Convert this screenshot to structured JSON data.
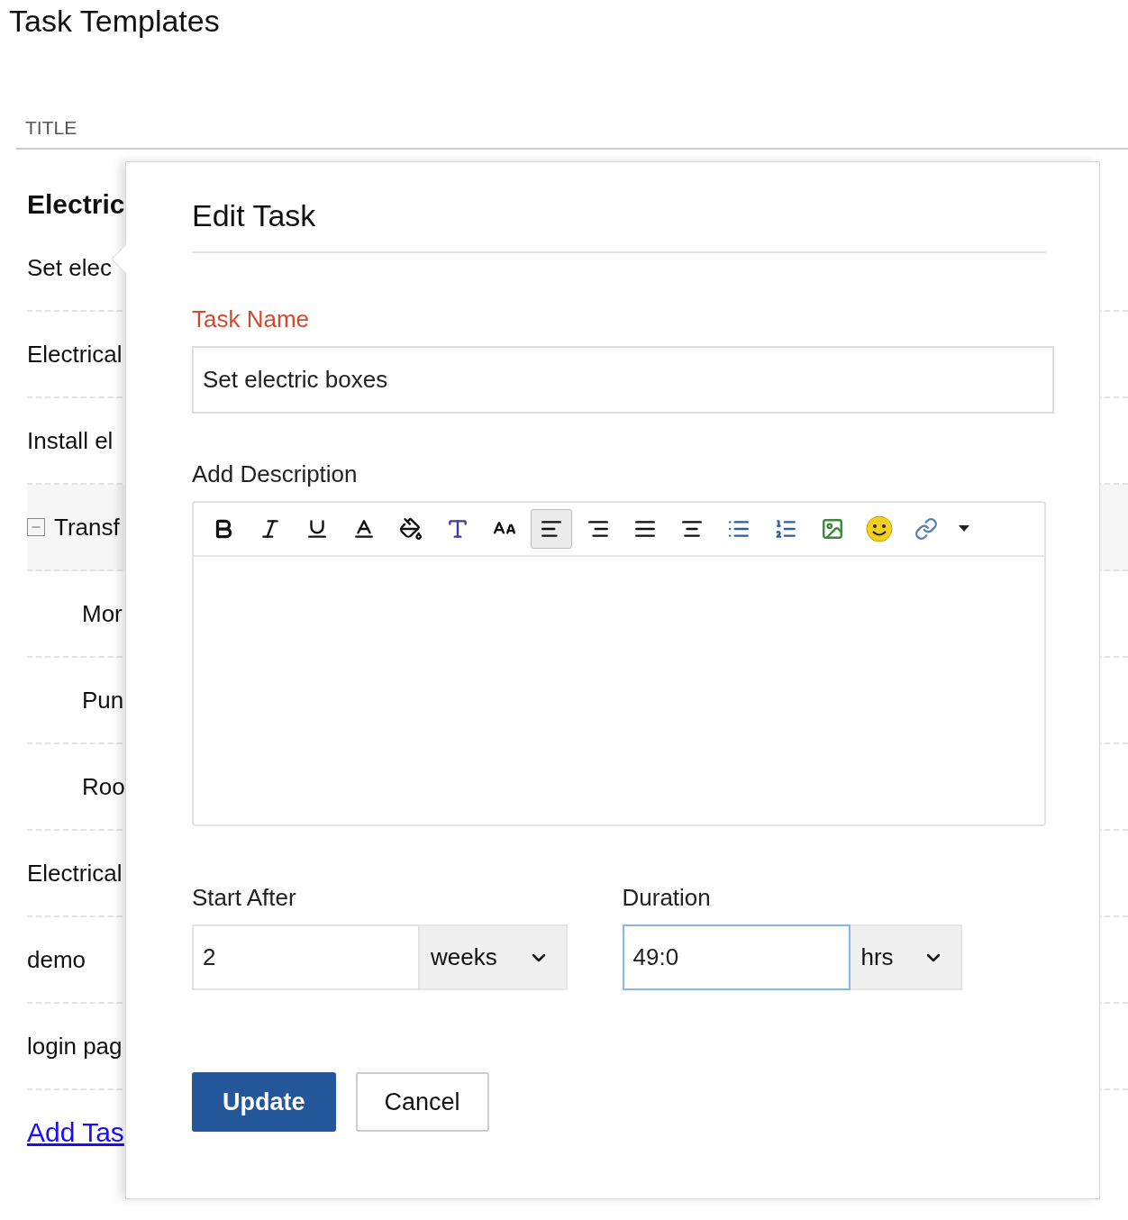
{
  "page": {
    "title": "Task Templates"
  },
  "table": {
    "column": "TITLE",
    "group": "Electric",
    "rows": [
      {
        "text": "Set elec"
      },
      {
        "text": "Electrical"
      },
      {
        "text": "Install el"
      },
      {
        "text": "Transf",
        "expanded": true,
        "children": [
          {
            "text": "Mor"
          },
          {
            "text": "Pun"
          },
          {
            "text": "Roo"
          }
        ]
      },
      {
        "text": "Electrical"
      },
      {
        "text": "demo"
      },
      {
        "text": "login pag"
      }
    ],
    "add_link": "Add Tas"
  },
  "dialog": {
    "title": "Edit Task",
    "task_name": {
      "label": "Task Name",
      "value": "Set electric boxes"
    },
    "description": {
      "label": "Add Description",
      "toolbar": [
        {
          "kind": "bold",
          "selected": false
        },
        {
          "kind": "italic",
          "selected": false
        },
        {
          "kind": "underline",
          "selected": false
        },
        {
          "kind": "font-color",
          "selected": false
        },
        {
          "kind": "fill",
          "selected": false
        },
        {
          "kind": "font-family",
          "selected": false
        },
        {
          "kind": "font-size",
          "selected": false
        },
        {
          "kind": "align-left",
          "selected": true
        },
        {
          "kind": "align-right",
          "selected": false
        },
        {
          "kind": "justify",
          "selected": false
        },
        {
          "kind": "align-center",
          "selected": false
        },
        {
          "kind": "bullets",
          "selected": false
        },
        {
          "kind": "numbers",
          "selected": false
        },
        {
          "kind": "image",
          "selected": false
        },
        {
          "kind": "emoji",
          "selected": false
        },
        {
          "kind": "link",
          "selected": false
        },
        {
          "kind": "more",
          "selected": false
        }
      ]
    },
    "start_after": {
      "label": "Start After",
      "value": "2",
      "unit": "weeks",
      "focused": false
    },
    "duration": {
      "label": "Duration",
      "value": "49:0",
      "unit": "hrs",
      "focused": true
    },
    "buttons": [
      {
        "label": "Update",
        "kind": "primary"
      },
      {
        "label": "Cancel",
        "kind": "secondary"
      }
    ]
  }
}
